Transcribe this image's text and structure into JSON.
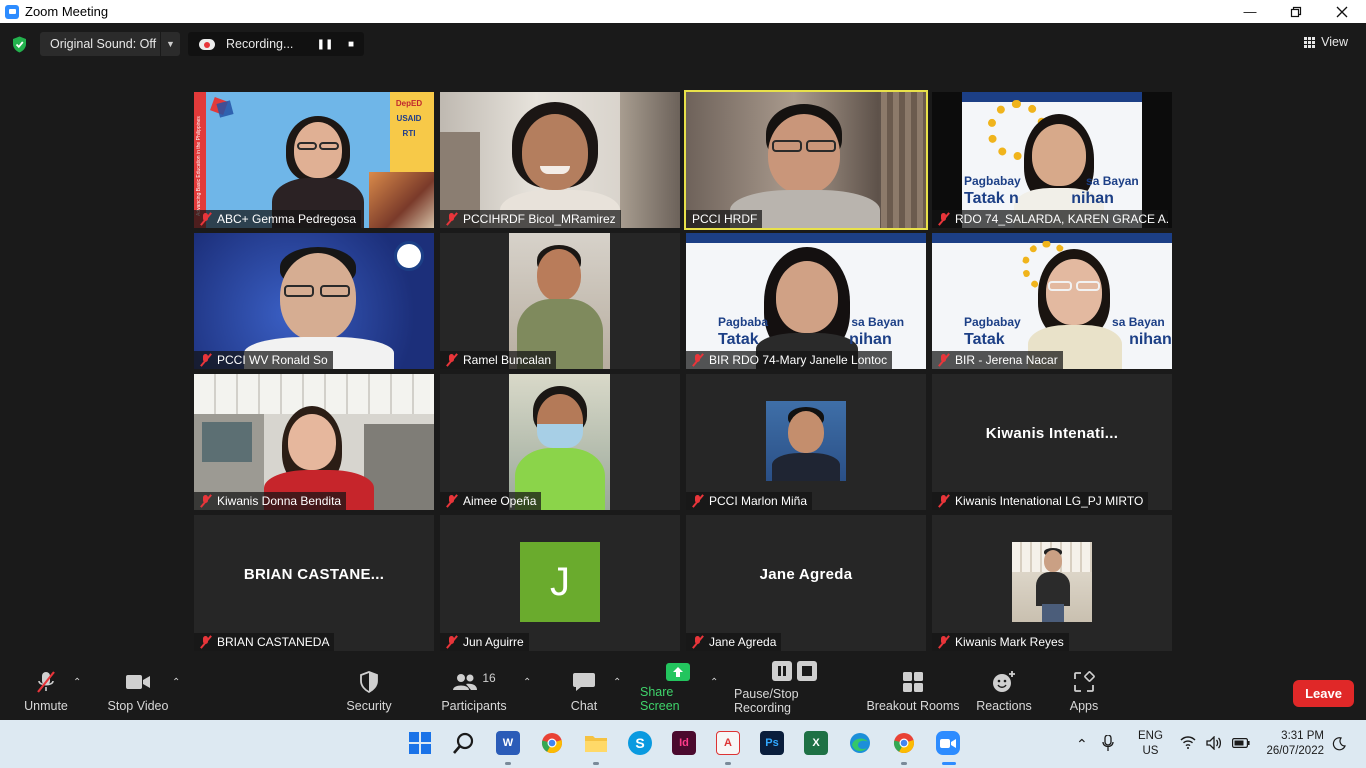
{
  "window": {
    "title": "Zoom Meeting",
    "controls": [
      "minimize-icon",
      "maximize-icon",
      "close-icon"
    ]
  },
  "topbar": {
    "original_sound": "Original Sound: Off",
    "recording": "Recording...",
    "view": "View"
  },
  "participants": [
    {
      "name": "ABC+ Gemma Pedregosa",
      "muted": true
    },
    {
      "name": "PCCIHRDF Bicol_MRamirez",
      "muted": true
    },
    {
      "name": "PCCI HRDF",
      "muted": false,
      "active_speaker": true
    },
    {
      "name": "RDO 74_SALARDA, KAREN GRACE A.",
      "muted": true,
      "background_text": [
        "Pagbabay",
        "sa Bayan",
        "Tatak n",
        "nihan"
      ]
    },
    {
      "name": "PCCI WV Ronald So",
      "muted": true
    },
    {
      "name": "Ramel Buncalan",
      "muted": true
    },
    {
      "name": "BIR RDO 74-Mary Janelle Lontoc",
      "muted": true,
      "background_text": [
        "Pagbaba",
        "sa Bayan",
        "Tatak",
        "nihan"
      ]
    },
    {
      "name": "BIR - Jerena Nacar",
      "muted": true,
      "background_text": [
        "Pagbabay",
        "sa Bayan",
        "Tatak",
        "nihan"
      ]
    },
    {
      "name": "Kiwanis Donna Bendita",
      "muted": true
    },
    {
      "name": "Aimee Opeña",
      "muted": true
    },
    {
      "name": "PCCI Marlon Miña",
      "muted": true
    },
    {
      "name": "Kiwanis Intenational LG_PJ MIRTO",
      "muted": true,
      "display": "Kiwanis  Intenati..."
    },
    {
      "name": "BRIAN CASTANEDA",
      "muted": true,
      "display": "BRIAN  CASTANE..."
    },
    {
      "name": "Jun Aguirre",
      "muted": true,
      "initial": "J"
    },
    {
      "name": "Jane Agreda",
      "muted": true,
      "display": "Jane Agreda"
    },
    {
      "name": "Kiwanis Mark Reyes",
      "muted": true
    }
  ],
  "tile0_logos": [
    "DepED",
    "USAID",
    "RTI",
    "Advancing Basic Education in the Philippines"
  ],
  "toolbar": {
    "unmute": "Unmute",
    "stop_video": "Stop Video",
    "security": "Security",
    "participants": "Participants",
    "participants_count": "16",
    "chat": "Chat",
    "share_screen": "Share Screen",
    "pause_stop_recording": "Pause/Stop Recording",
    "breakout_rooms": "Breakout Rooms",
    "reactions": "Reactions",
    "apps": "Apps",
    "leave": "Leave"
  },
  "taskbar": {
    "apps": [
      "start-icon",
      "search-icon",
      "word-icon",
      "chrome-icon",
      "file-explorer-icon",
      "skype-icon",
      "indesign-icon",
      "acrobat-icon",
      "photoshop-icon",
      "excel-icon",
      "edge-icon",
      "chrome-icon",
      "zoom-icon"
    ],
    "lang_top": "ENG",
    "lang_bottom": "US",
    "time": "3:31 PM",
    "date": "26/07/2022"
  },
  "colors": {
    "background": "#1a1a1a",
    "active_speaker_border": "#e8e14a",
    "muted_icon": "#e8353a",
    "share_green": "#23c55e",
    "leave_red": "#e02828",
    "taskbar": "#dde9f2",
    "avatar_green": "#6aab2d"
  }
}
